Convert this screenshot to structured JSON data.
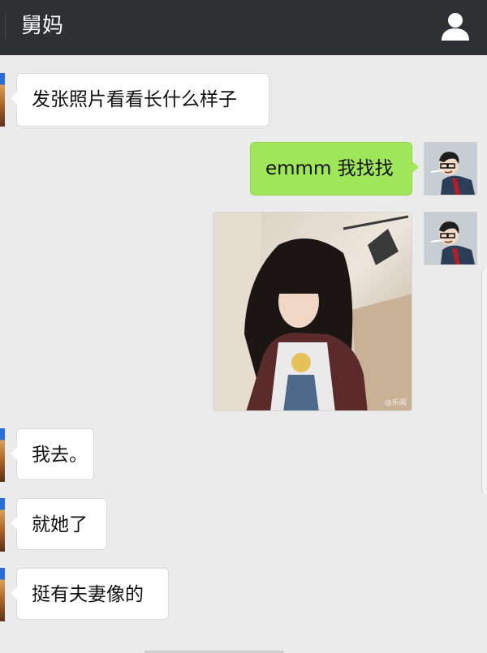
{
  "header": {
    "title": "舅妈",
    "profile_icon": "person-icon"
  },
  "messages": [
    {
      "side": "in",
      "text": "发张照片看看长什么样子"
    },
    {
      "side": "out",
      "text": "emmm 我找找"
    },
    {
      "side": "out",
      "type": "image",
      "watermark": "@乐阅"
    },
    {
      "side": "in",
      "text": "我去。"
    },
    {
      "side": "in",
      "text": "就她了"
    },
    {
      "side": "in",
      "text": "挺有夫妻像的"
    }
  ],
  "colors": {
    "header_bg": "#2f3033",
    "chat_bg": "#ebebeb",
    "outgoing_bubble": "#9fe65a",
    "incoming_bubble": "#ffffff"
  }
}
